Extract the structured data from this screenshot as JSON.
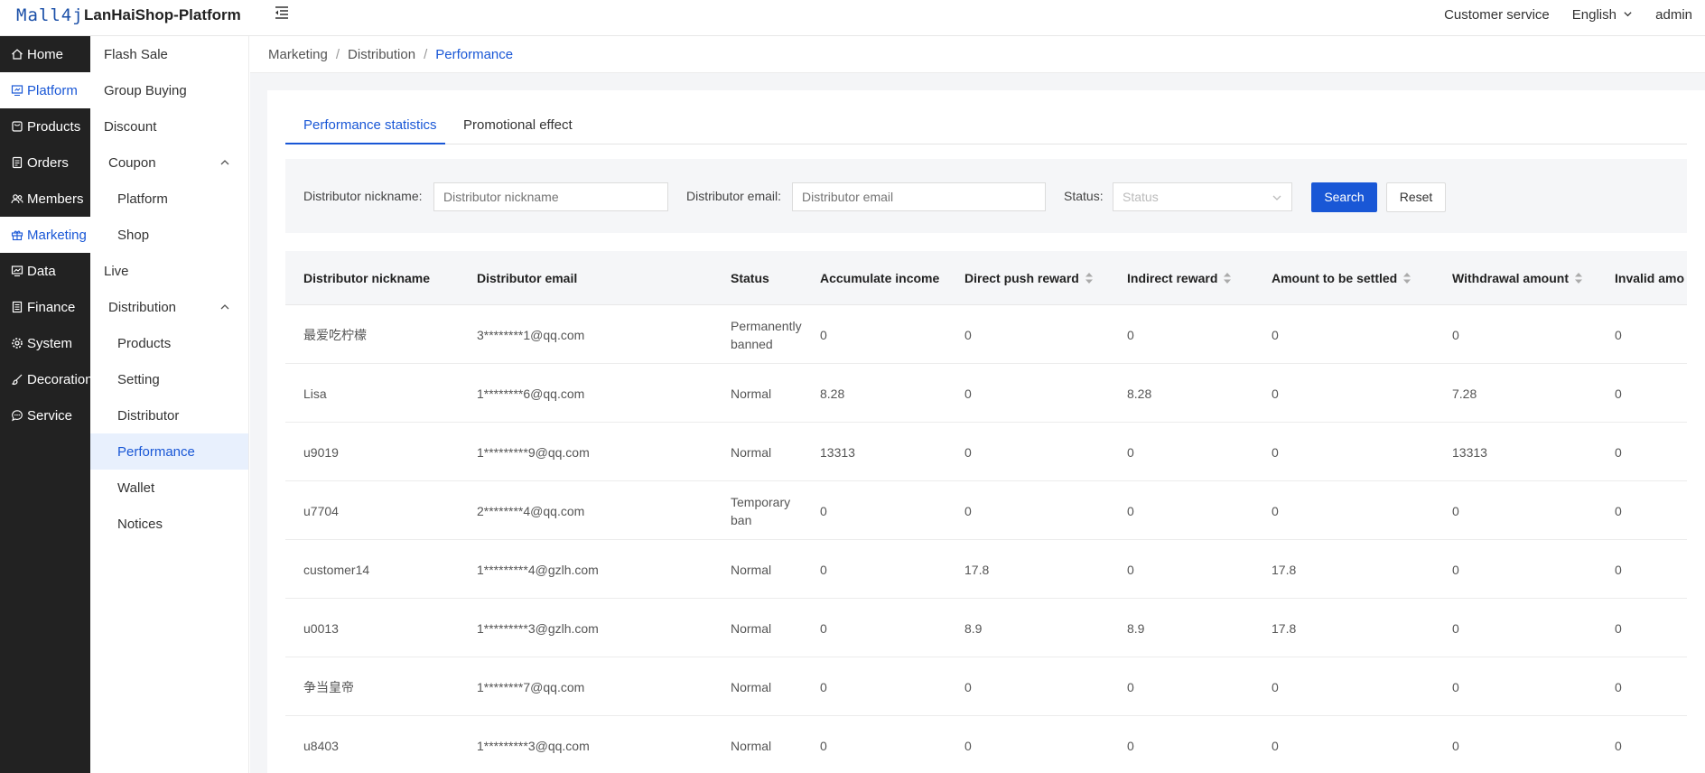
{
  "header": {
    "logo_text": "Mall4j",
    "brand": "LanHaiShop-Platform",
    "customer_service": "Customer service",
    "language": "English",
    "user": "admin"
  },
  "sidebar": {
    "items": [
      {
        "label": "Home",
        "icon": "home-icon"
      },
      {
        "label": "Platform",
        "icon": "monitor-icon"
      },
      {
        "label": "Products",
        "icon": "bag-icon"
      },
      {
        "label": "Orders",
        "icon": "document-icon"
      },
      {
        "label": "Members",
        "icon": "users-icon"
      },
      {
        "label": "Marketing",
        "icon": "gift-icon"
      },
      {
        "label": "Data",
        "icon": "chart-icon"
      },
      {
        "label": "Finance",
        "icon": "finance-icon"
      },
      {
        "label": "System",
        "icon": "gear-icon"
      },
      {
        "label": "Decoration",
        "icon": "brush-icon"
      },
      {
        "label": "Service",
        "icon": "chat-icon"
      }
    ]
  },
  "submenu": {
    "items": [
      {
        "label": "Flash Sale"
      },
      {
        "label": "Group Buying"
      },
      {
        "label": "Discount"
      },
      {
        "label": "Coupon"
      },
      {
        "label": "Platform"
      },
      {
        "label": "Shop"
      },
      {
        "label": "Live"
      },
      {
        "label": "Distribution"
      },
      {
        "label": "Products"
      },
      {
        "label": "Setting"
      },
      {
        "label": "Distributor"
      },
      {
        "label": "Performance"
      },
      {
        "label": "Wallet"
      },
      {
        "label": "Notices"
      }
    ]
  },
  "breadcrumb": {
    "items": [
      "Marketing",
      "Distribution",
      "Performance"
    ],
    "separator": "/"
  },
  "tabs": [
    {
      "label": "Performance statistics",
      "active": true
    },
    {
      "label": "Promotional effect",
      "active": false
    }
  ],
  "filter": {
    "nickname_label": "Distributor nickname:",
    "nickname_placeholder": "Distributor nickname",
    "email_label": "Distributor email:",
    "email_placeholder": "Distributor email",
    "status_label": "Status:",
    "status_placeholder": "Status",
    "search_label": "Search",
    "reset_label": "Reset"
  },
  "table": {
    "columns": [
      {
        "label": "Distributor nickname",
        "sortable": false
      },
      {
        "label": "Distributor email",
        "sortable": false
      },
      {
        "label": "Status",
        "sortable": false
      },
      {
        "label": "Accumulate income",
        "sortable": false
      },
      {
        "label": "Direct push reward",
        "sortable": true
      },
      {
        "label": "Indirect reward",
        "sortable": true
      },
      {
        "label": "Amount to be settled",
        "sortable": true
      },
      {
        "label": "Withdrawal amount",
        "sortable": true
      },
      {
        "label": "Invalid amo",
        "sortable": false
      }
    ],
    "rows": [
      [
        "最爱吃柠檬",
        "3********1@qq.com",
        "Permanently banned",
        "0",
        "0",
        "0",
        "0",
        "0",
        "0"
      ],
      [
        "Lisa",
        "1********6@qq.com",
        "Normal",
        "8.28",
        "0",
        "8.28",
        "0",
        "7.28",
        "0"
      ],
      [
        "u9019",
        "1*********9@qq.com",
        "Normal",
        "13313",
        "0",
        "0",
        "0",
        "13313",
        "0"
      ],
      [
        "u7704",
        "2********4@qq.com",
        "Temporary ban",
        "0",
        "0",
        "0",
        "0",
        "0",
        "0"
      ],
      [
        "customer14",
        "1*********4@gzlh.com",
        "Normal",
        "0",
        "17.8",
        "0",
        "17.8",
        "0",
        "0"
      ],
      [
        "u0013",
        "1*********3@gzlh.com",
        "Normal",
        "0",
        "8.9",
        "8.9",
        "17.8",
        "0",
        "0"
      ],
      [
        "争当皇帝",
        "1********7@qq.com",
        "Normal",
        "0",
        "0",
        "0",
        "0",
        "0",
        "0"
      ],
      [
        "u8403",
        "1*********3@qq.com",
        "Normal",
        "0",
        "0",
        "0",
        "0",
        "0",
        "0"
      ]
    ]
  },
  "colors": {
    "accent": "#1957d6",
    "sidebar_bg": "#222222",
    "page_bg": "#f4f5f7"
  }
}
